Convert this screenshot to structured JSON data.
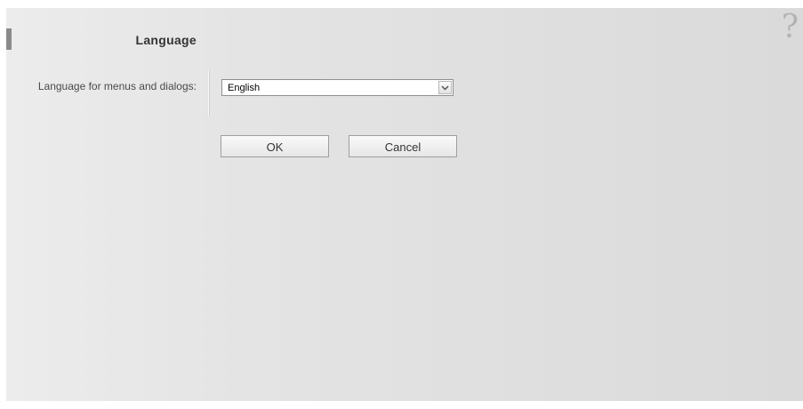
{
  "page": {
    "title": "Language",
    "help_symbol": "?"
  },
  "form": {
    "language_label": "Language for menus and dialogs:",
    "language_value": "English"
  },
  "buttons": {
    "ok_label": "OK",
    "cancel_label": "Cancel"
  },
  "icons": {
    "help": "help-icon",
    "dropdown": "chevron-down-icon"
  }
}
